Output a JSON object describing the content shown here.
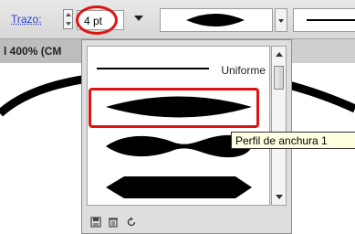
{
  "toolbar": {
    "stroke_label": "Trazo:",
    "width_value": "4 pt"
  },
  "document": {
    "tab_label": "l 400% (CM"
  },
  "profile_panel": {
    "items": [
      {
        "label": "Uniforme",
        "shape": "uniform-line"
      },
      {
        "label": "",
        "shape": "lens-profile",
        "selected": true
      },
      {
        "label": "",
        "shape": "wave-profile"
      },
      {
        "label": "",
        "shape": "hexagon-profile"
      }
    ],
    "footer_icons": [
      "save-icon",
      "delete-icon",
      "reset-icon"
    ]
  },
  "tooltip": {
    "text": "Perfil de anchura 1"
  },
  "colors": {
    "highlight": "#e01313",
    "label_blue": "#2b3fd0",
    "tooltip_bg": "#ffffe1"
  }
}
